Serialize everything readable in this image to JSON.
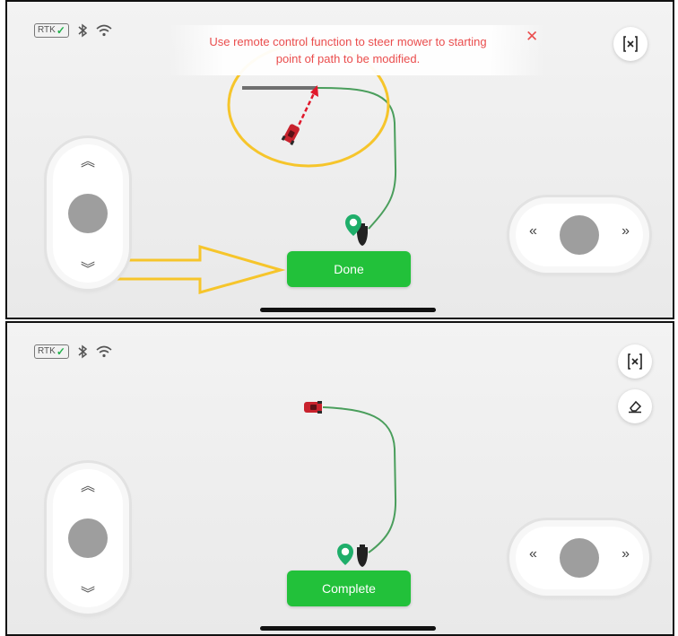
{
  "status_bar": {
    "rtk_label": "RTK",
    "icons": [
      "rtk-check-icon",
      "bluetooth-icon",
      "wifi-icon"
    ]
  },
  "panel1": {
    "banner_text": "Use remote control function to steer mower to starting point of path to be modified.",
    "action_label": "Done"
  },
  "panel2": {
    "action_label": "Complete"
  },
  "controls": {
    "up_arrow": "«",
    "down_arrow": "»",
    "left_arrow": "«",
    "right_arrow": "»"
  },
  "colors": {
    "accent_green": "#22c13a",
    "banner_red": "#ea4d4d",
    "annotation_yellow": "#f6c52b",
    "path_green": "#4a9e5c",
    "mower_red": "#c8222d",
    "arrow_red": "#e0182b"
  }
}
